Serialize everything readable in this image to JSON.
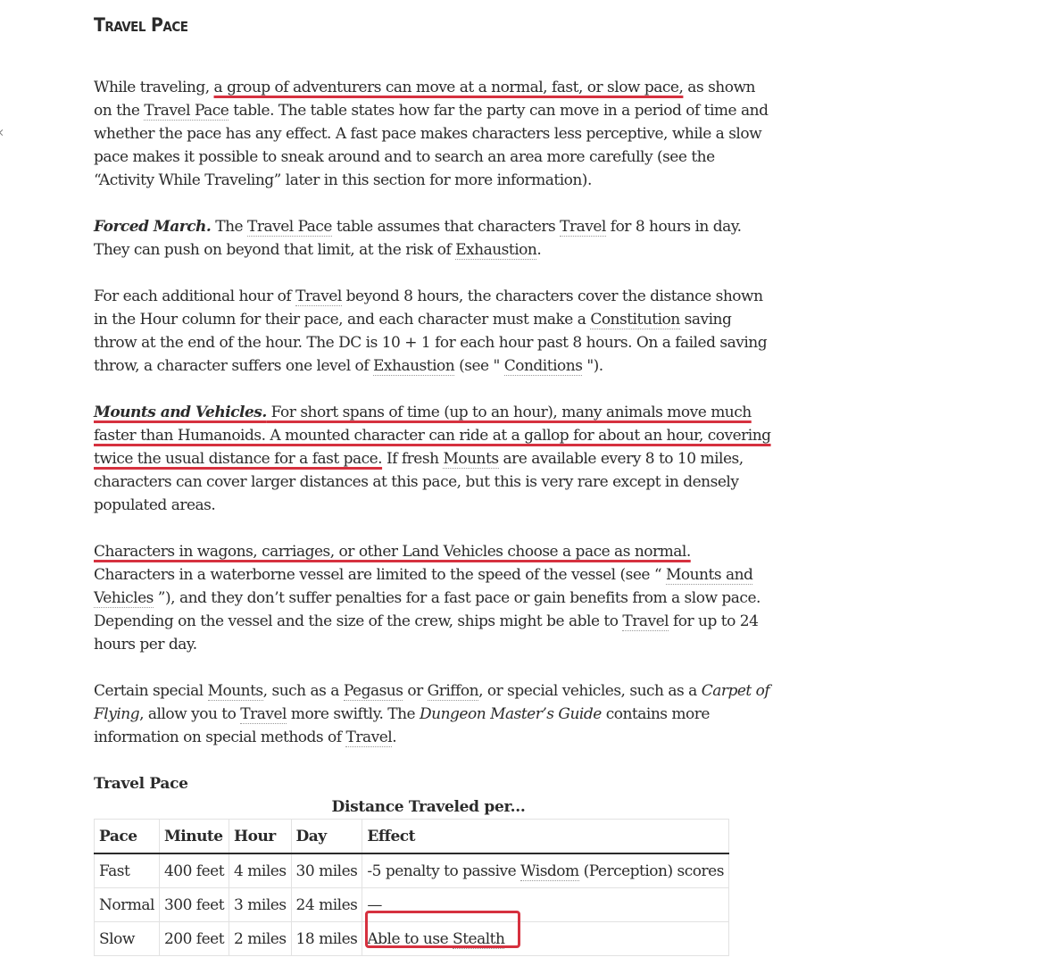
{
  "section": {
    "heading": "Travel Pace"
  },
  "p1": {
    "a": "While traveling, ",
    "hl": "a group of adventurers can move at a normal, fast, or slow pace,",
    "b": " as shown on the ",
    "link_travel_pace": "Travel Pace",
    "c": " table. The table states how far the party can move in a period of time and whether the pace has any effect. A fast pace makes characters less perceptive, while a slow pace makes it possible to sneak around and to search an area more carefully (see the “Activity While Traveling” later in this section for more information)."
  },
  "p2": {
    "runin": "Forced March.",
    "a": " The ",
    "link_travel_pace": "Travel Pace",
    "b": " table assumes that characters ",
    "link_travel": "Travel",
    "c": " for 8 hours in day. They can push on beyond that limit, at the risk of ",
    "link_exhaustion": "Exhaustion",
    "d": "."
  },
  "p3": {
    "a": "For each additional hour of ",
    "link_travel": "Travel",
    "b": " beyond 8 hours, the characters cover the distance shown in the Hour column for their pace, and each character must make a ",
    "link_constitution": "Constitution",
    "c": " saving throw at the end of the hour. The DC is 10 + 1 for each hour past 8 hours. On a failed saving throw, a character suffers one level of ",
    "link_exhaustion": "Exhaustion",
    "d": " (see \" ",
    "link_conditions": "Conditions",
    "e": " \")."
  },
  "p4": {
    "runin": "Mounts and Vehicles.",
    "hl": " For short spans of time (up to an hour), many animals move much faster than Humanoids. A mounted character can ride at a gallop for about an hour, covering twice the usual distance for a fast pace.",
    "a": " If fresh ",
    "link_mounts": "Mounts",
    "b": " are available every 8 to 10 miles, characters can cover larger distances at this pace, but this is very rare except in densely populated areas."
  },
  "p5": {
    "hl": "Characters in wagons, carriages, or other Land Vehicles choose a pace as normal.",
    "a": " Characters in a waterborne vessel are limited to the speed of the vessel (see “ ",
    "link_mounts_vehicles": "Mounts and Vehicles",
    "b": " ”), and they don’t suffer penalties for a fast pace or gain benefits from a slow pace. Depending on the vessel and the size of the crew, ships might be able to ",
    "link_travel": "Travel",
    "c": " for up to 24 hours per day."
  },
  "p6": {
    "a": "Certain special ",
    "link_mounts": "Mounts",
    "b": ", such as a ",
    "link_pegasus": "Pegasus",
    "c": " or ",
    "link_griffon": "Griffon",
    "d": ", or special vehicles, such as a ",
    "book1": "Carpet of Flying",
    "e": ", allow you to ",
    "link_travel": "Travel",
    "f": " more swiftly. The ",
    "book2": "Dungeon Master’s Guide",
    "g": " contains more information on special methods of ",
    "link_travel2": "Travel",
    "h": "."
  },
  "table": {
    "title": "Travel Pace",
    "caption": "Distance Traveled per...",
    "headers": [
      "Pace",
      "Minute",
      "Hour",
      "Day",
      "Effect"
    ],
    "rows": [
      {
        "pace": "Fast",
        "minute": "400 feet",
        "hour": "4 miles",
        "day": "30 miles",
        "effect_a": "-5 penalty to passive ",
        "effect_link": "Wisdom",
        "effect_b": " (Perception) scores"
      },
      {
        "pace": "Normal",
        "minute": "300 feet",
        "hour": "3 miles",
        "day": "24 miles",
        "effect_a": "—",
        "effect_link": "",
        "effect_b": ""
      },
      {
        "pace": "Slow",
        "minute": "200 feet",
        "hour": "2 miles",
        "day": "18 miles",
        "effect_a": "Able to use ",
        "effect_link": "Stealth",
        "effect_b": ""
      }
    ]
  },
  "colors": {
    "highlight": "#d6313f",
    "text": "#2b2b2b"
  }
}
